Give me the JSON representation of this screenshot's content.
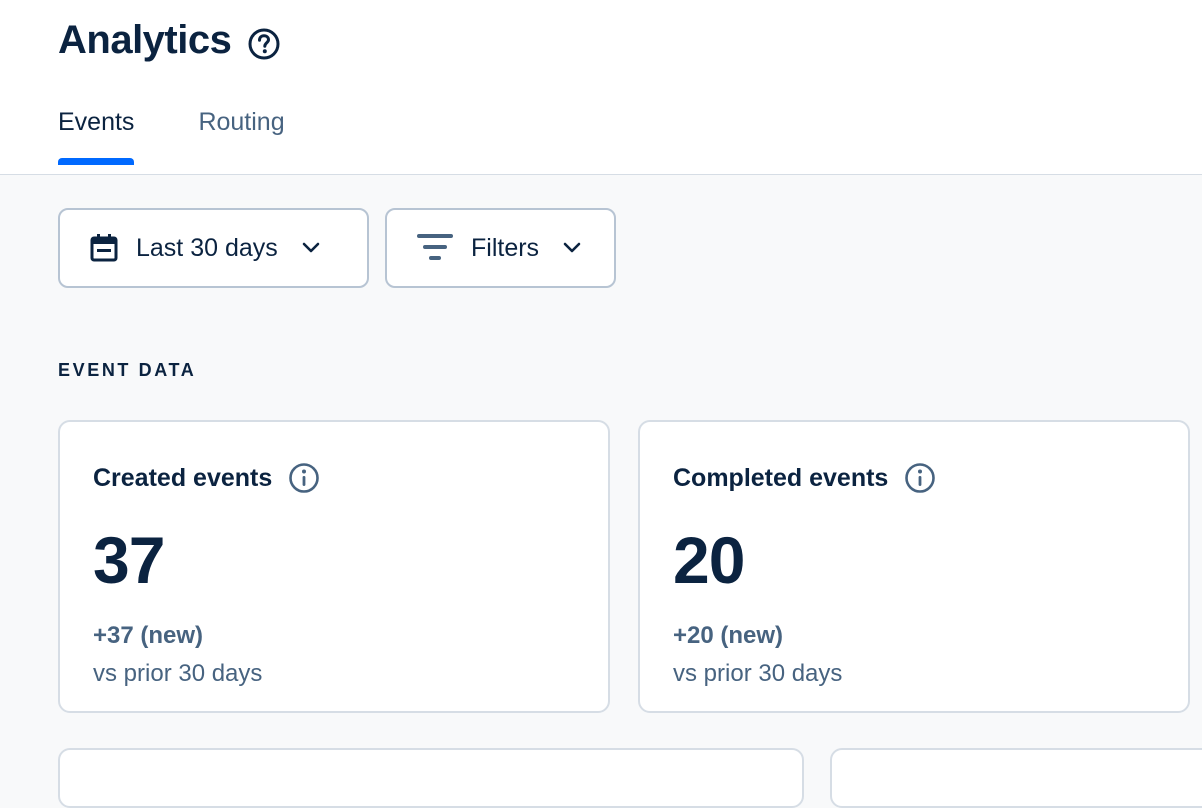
{
  "page": {
    "title": "Analytics",
    "help_icon": "question-circle-icon"
  },
  "tabs": [
    {
      "label": "Events",
      "active": true
    },
    {
      "label": "Routing",
      "active": false
    }
  ],
  "controls": {
    "date_range": {
      "label": "Last 30 days",
      "icon": "calendar-icon"
    },
    "filters": {
      "label": "Filters",
      "icon": "filter-icon"
    }
  },
  "section": {
    "label": "EVENT DATA"
  },
  "cards": [
    {
      "title": "Created events",
      "value": "37",
      "delta": "+37 (new)",
      "compare": "vs prior 30 days"
    },
    {
      "title": "Completed events",
      "value": "20",
      "delta": "+20 (new)",
      "compare": "vs prior 30 days"
    }
  ],
  "colors": {
    "accent": "#0069ff",
    "text_primary": "#0b2340",
    "text_secondary": "#476380",
    "border": "#d6dde5"
  }
}
